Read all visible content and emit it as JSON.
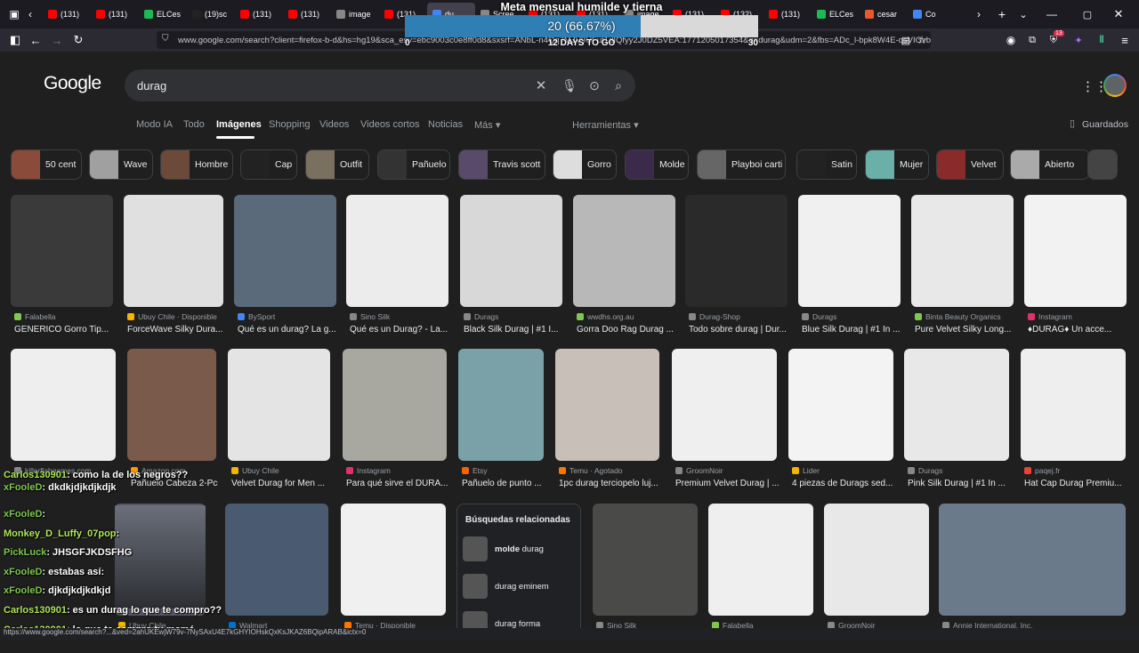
{
  "browser": {
    "tabs": [
      {
        "label": "(131)",
        "color": "#ff0000"
      },
      {
        "label": "(131)",
        "color": "#ff0000"
      },
      {
        "label": "ELCes",
        "color": "#1db954"
      },
      {
        "label": "(19)sc",
        "color": "#222222"
      },
      {
        "label": "(131)",
        "color": "#ff0000"
      },
      {
        "label": "(131)",
        "color": "#ff0000"
      },
      {
        "label": "image",
        "color": "#888888"
      },
      {
        "label": "(131)",
        "color": "#ff0000"
      },
      {
        "label": "du",
        "color": "#4285f4"
      },
      {
        "label": "Scree",
        "color": "#888888"
      },
      {
        "label": "(131)",
        "color": "#ff0000"
      },
      {
        "label": "(131)",
        "color": "#ff0000"
      },
      {
        "label": "image",
        "color": "#888888"
      },
      {
        "label": "(131)",
        "color": "#ff0000"
      },
      {
        "label": "(132)",
        "color": "#ff0000"
      },
      {
        "label": "(131)",
        "color": "#ff0000"
      },
      {
        "label": "ELCes",
        "color": "#1db954"
      },
      {
        "label": "cesar",
        "color": "#e55b2b"
      },
      {
        "label": "Co",
        "color": "#4285f4"
      }
    ],
    "url": "www.google.com/search?client=firefox-b-d&hs=hg19&sca_esv=ebc9003c0e8ff0d8&sxsrf=ANbL-n4Qq7MJV9UFut1dIQfyy2J0DZ5VEA:1771205017354&q=durag&udm=2&fbs=ADc_l-bpk8W4E-qsVIOvbG...",
    "extension_badge": "13"
  },
  "goal_overlay": {
    "title": "Meta mensual humilde y tierna",
    "percent_text": "20 (66.67%)",
    "progress_fraction": 0.6667,
    "left_label": "0",
    "center_label": "12 DAYS TO GO",
    "right_label": "30"
  },
  "google": {
    "logo": "Google",
    "query": "durag",
    "saved_label": "Guardados",
    "tabs": [
      "Modo IA",
      "Todo",
      "Imágenes",
      "Shopping",
      "Videos",
      "Videos cortos",
      "Noticias",
      "Más ▾"
    ],
    "tools_label": "Herramientas ▾",
    "chips": [
      "50 cent",
      "Wave",
      "Hombre",
      "Cap",
      "Outfit",
      "Pañuelo",
      "Travis scott",
      "Gorro",
      "Molde",
      "Playboi carti",
      "Satin",
      "Mujer",
      "Velvet",
      "Abierto"
    ],
    "row1": [
      {
        "source": "Falabella",
        "title": "GENERICO Gorro Tip...",
        "color": "#7ec850"
      },
      {
        "source": "Ubuy Chile · Disponible",
        "title": "ForceWave Silky Dura...",
        "color": "#f4b400"
      },
      {
        "source": "BySport",
        "title": "Qué es un durag? La g...",
        "color": "#4285f4"
      },
      {
        "source": "Sino Silk",
        "title": "Qué es un Durag? - La...",
        "color": "#888888"
      },
      {
        "source": "Durags",
        "title": "Black Silk Durag | #1 I...",
        "color": "#888888"
      },
      {
        "source": "wwdhs.org.au",
        "title": "Gorra Doo Rag Durag ...",
        "color": "#7ec850"
      },
      {
        "source": "Durag-Shop",
        "title": "Todo sobre durag | Dur...",
        "color": "#888888"
      },
      {
        "source": "Durags",
        "title": "Blue Silk Durag | #1 In ...",
        "color": "#888888"
      },
      {
        "source": "Binta Beauty Organics",
        "title": "Pure Velvet Silky Long...",
        "color": "#7ec850"
      },
      {
        "source": "Instagram",
        "title": "♦DURAG♦ Un acce...",
        "color": "#e1306c"
      }
    ],
    "row2": [
      {
        "source": "killerfishgames.com",
        "title": "",
        "color": "#888888"
      },
      {
        "source": "Amazon.com",
        "title": "Pañuelo Cabeza 2-Pcs ...",
        "color": "#ff9900"
      },
      {
        "source": "Ubuy Chile",
        "title": "Velvet Durag for Men ...",
        "color": "#f4b400"
      },
      {
        "source": "Instagram",
        "title": "Para qué sirve el DURA...",
        "color": "#e1306c"
      },
      {
        "source": "Etsy",
        "title": "Pañuelo de punto ...",
        "color": "#f56400"
      },
      {
        "source": "Temu · Agotado",
        "title": "1pc durag terciopelo luj...",
        "color": "#fb7701"
      },
      {
        "source": "GroomNoir",
        "title": "Premium Velvet Durag | ...",
        "color": "#888888"
      },
      {
        "source": "Lider",
        "title": "4 piezas de Durags sed...",
        "color": "#f4b400"
      },
      {
        "source": "Durags",
        "title": "Pink Silk Durag | #1 In ...",
        "color": "#888888"
      },
      {
        "source": "paqej.fr",
        "title": "Hat Cap Durag Premiu...",
        "color": "#ea4335"
      }
    ],
    "row3": [
      {
        "source": "Ubuy Chile",
        "color": "#f4b400"
      },
      {
        "source": "Walmart",
        "color": "#0071ce"
      },
      {
        "source": "Temu · Disponible",
        "color": "#fb7701"
      },
      {
        "source": "Sino Silk",
        "color": "#888888"
      },
      {
        "source": "Falabella",
        "color": "#7ec850"
      },
      {
        "source": "GroomNoir",
        "color": "#888888"
      },
      {
        "source": "Annie International, Inc.",
        "color": "#888888"
      }
    ],
    "related": {
      "heading": "Búsquedas relacionadas",
      "items": [
        {
          "bold": "molde",
          "rest": " durag"
        },
        {
          "bold": "",
          "rest": "durag eminem"
        },
        {
          "bold": "",
          "rest": "durag forma"
        }
      ]
    }
  },
  "chat": [
    {
      "user": "Carlos130901",
      "msg": ": como la de los negros??"
    },
    {
      "user": "xFooleD",
      "msg": ": dkdkjdjkdjkdjk"
    },
    {
      "user": "xFooleD",
      "msg": ":"
    },
    {
      "user": "Monkey_D_Luffy_07pop",
      "msg": ":"
    },
    {
      "user": "PickLuck",
      "msg": ": JHSGFJKDSFHG"
    },
    {
      "user": "xFooleD",
      "msg": ": estabas así:"
    },
    {
      "user": "xFooleD",
      "msg": ": djkdjkdjkdkjd"
    },
    {
      "user": "Carlos130901",
      "msg": ": es un durag lo que te compro??"
    },
    {
      "user": "Carlos130901",
      "msg": ": lo que te compro tu mamá"
    }
  ],
  "status_url": "https://www.google.com/search?...&ved=2ahUKEwjW79v-7NySAxU4E7kGHYIOHskQxKsJKAZ6BQipARAB&ictx=0"
}
